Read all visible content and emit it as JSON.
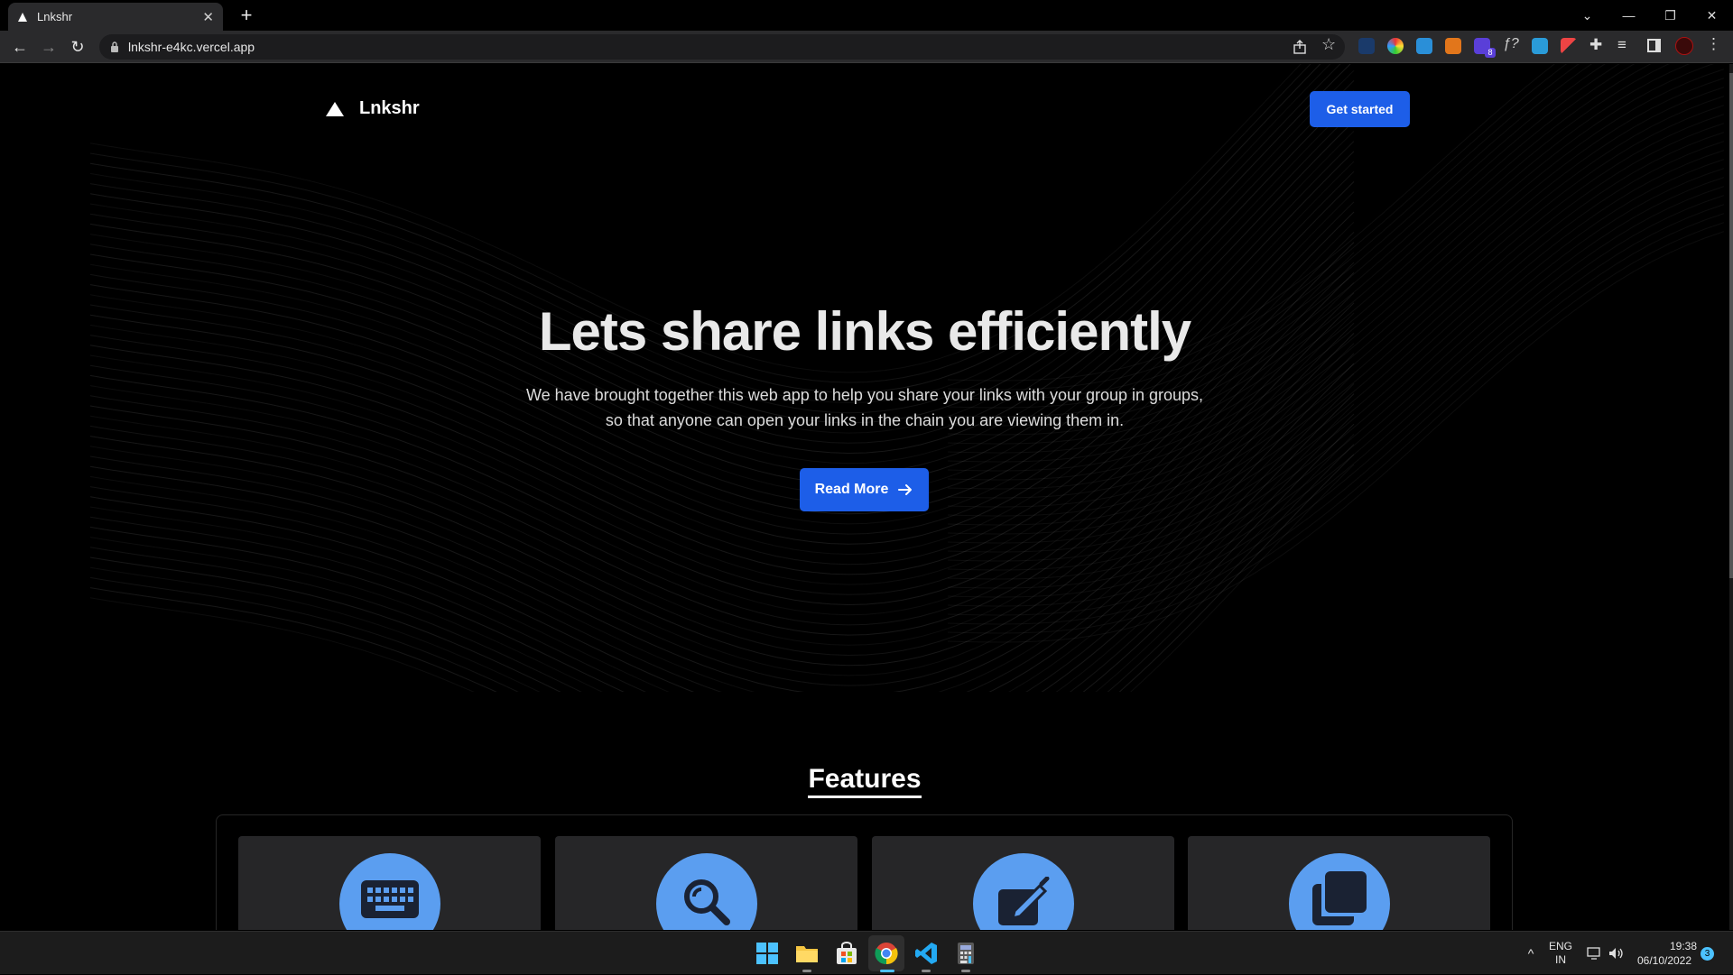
{
  "browser": {
    "tab_title": "Lnkshr",
    "url": "lnkshr-e4kc.vercel.app"
  },
  "site": {
    "brand": "Lnkshr",
    "get_started_label": "Get started",
    "headline": "Lets share links efficiently",
    "subtext_line1": "We have brought together this web app to help you share your links with your group in groups,",
    "subtext_line2": "so that anyone can open your links in the chain you are viewing them in.",
    "read_more_label": "Read More",
    "features_title": "Features",
    "feature_icons": [
      "keyboard-icon",
      "search-icon",
      "edit-icon",
      "copy-icon"
    ],
    "accent_color": "#1d5ee8",
    "feature_circle_color": "#5b9ef0"
  },
  "extensions": {
    "badge_count": "8"
  },
  "taskbar": {
    "lang_line1": "ENG",
    "lang_line2": "IN",
    "time": "19:38",
    "date": "06/10/2022",
    "notification_count": "3"
  }
}
